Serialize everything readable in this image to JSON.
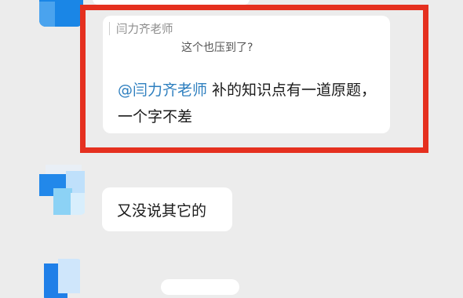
{
  "chat": {
    "quoted_message": {
      "author": "闫力齐老师",
      "text": "这个也压到了?"
    },
    "main_message": {
      "mention": "@闫力齐老师",
      "text": " 补的知识点有一道原题，一个字不差"
    },
    "reply_message": {
      "text": "又没说其它的"
    }
  },
  "colors": {
    "background": "#ececec",
    "bubble": "#ffffff",
    "mention": "#2e7fbf",
    "highlight": "#e5301f",
    "avatar_blue": "#1f7fe8"
  }
}
